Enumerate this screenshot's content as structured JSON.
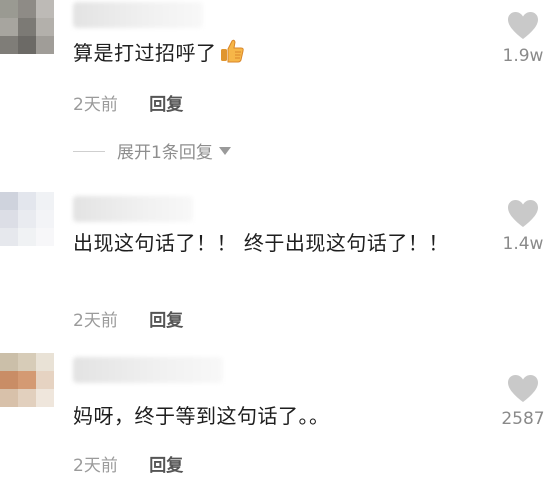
{
  "comments": [
    {
      "text": "算是打过招呼了",
      "emoji": "thumbs-up-icon",
      "time": "2天前",
      "reply_label": "回复",
      "likes": "1.9w",
      "expand_label": "展开1条回复"
    },
    {
      "text": "出现这句话了！！ 终于出现这句话了！！",
      "time": "2天前",
      "reply_label": "回复",
      "likes": "1.4w"
    },
    {
      "text": "妈呀，终于等到这句话了。。",
      "time": "2天前",
      "reply_label": "回复",
      "likes": "2587"
    }
  ],
  "colors": {
    "heart": "#c9c9c9",
    "meta": "#9b9b9b",
    "reply": "#555555"
  }
}
